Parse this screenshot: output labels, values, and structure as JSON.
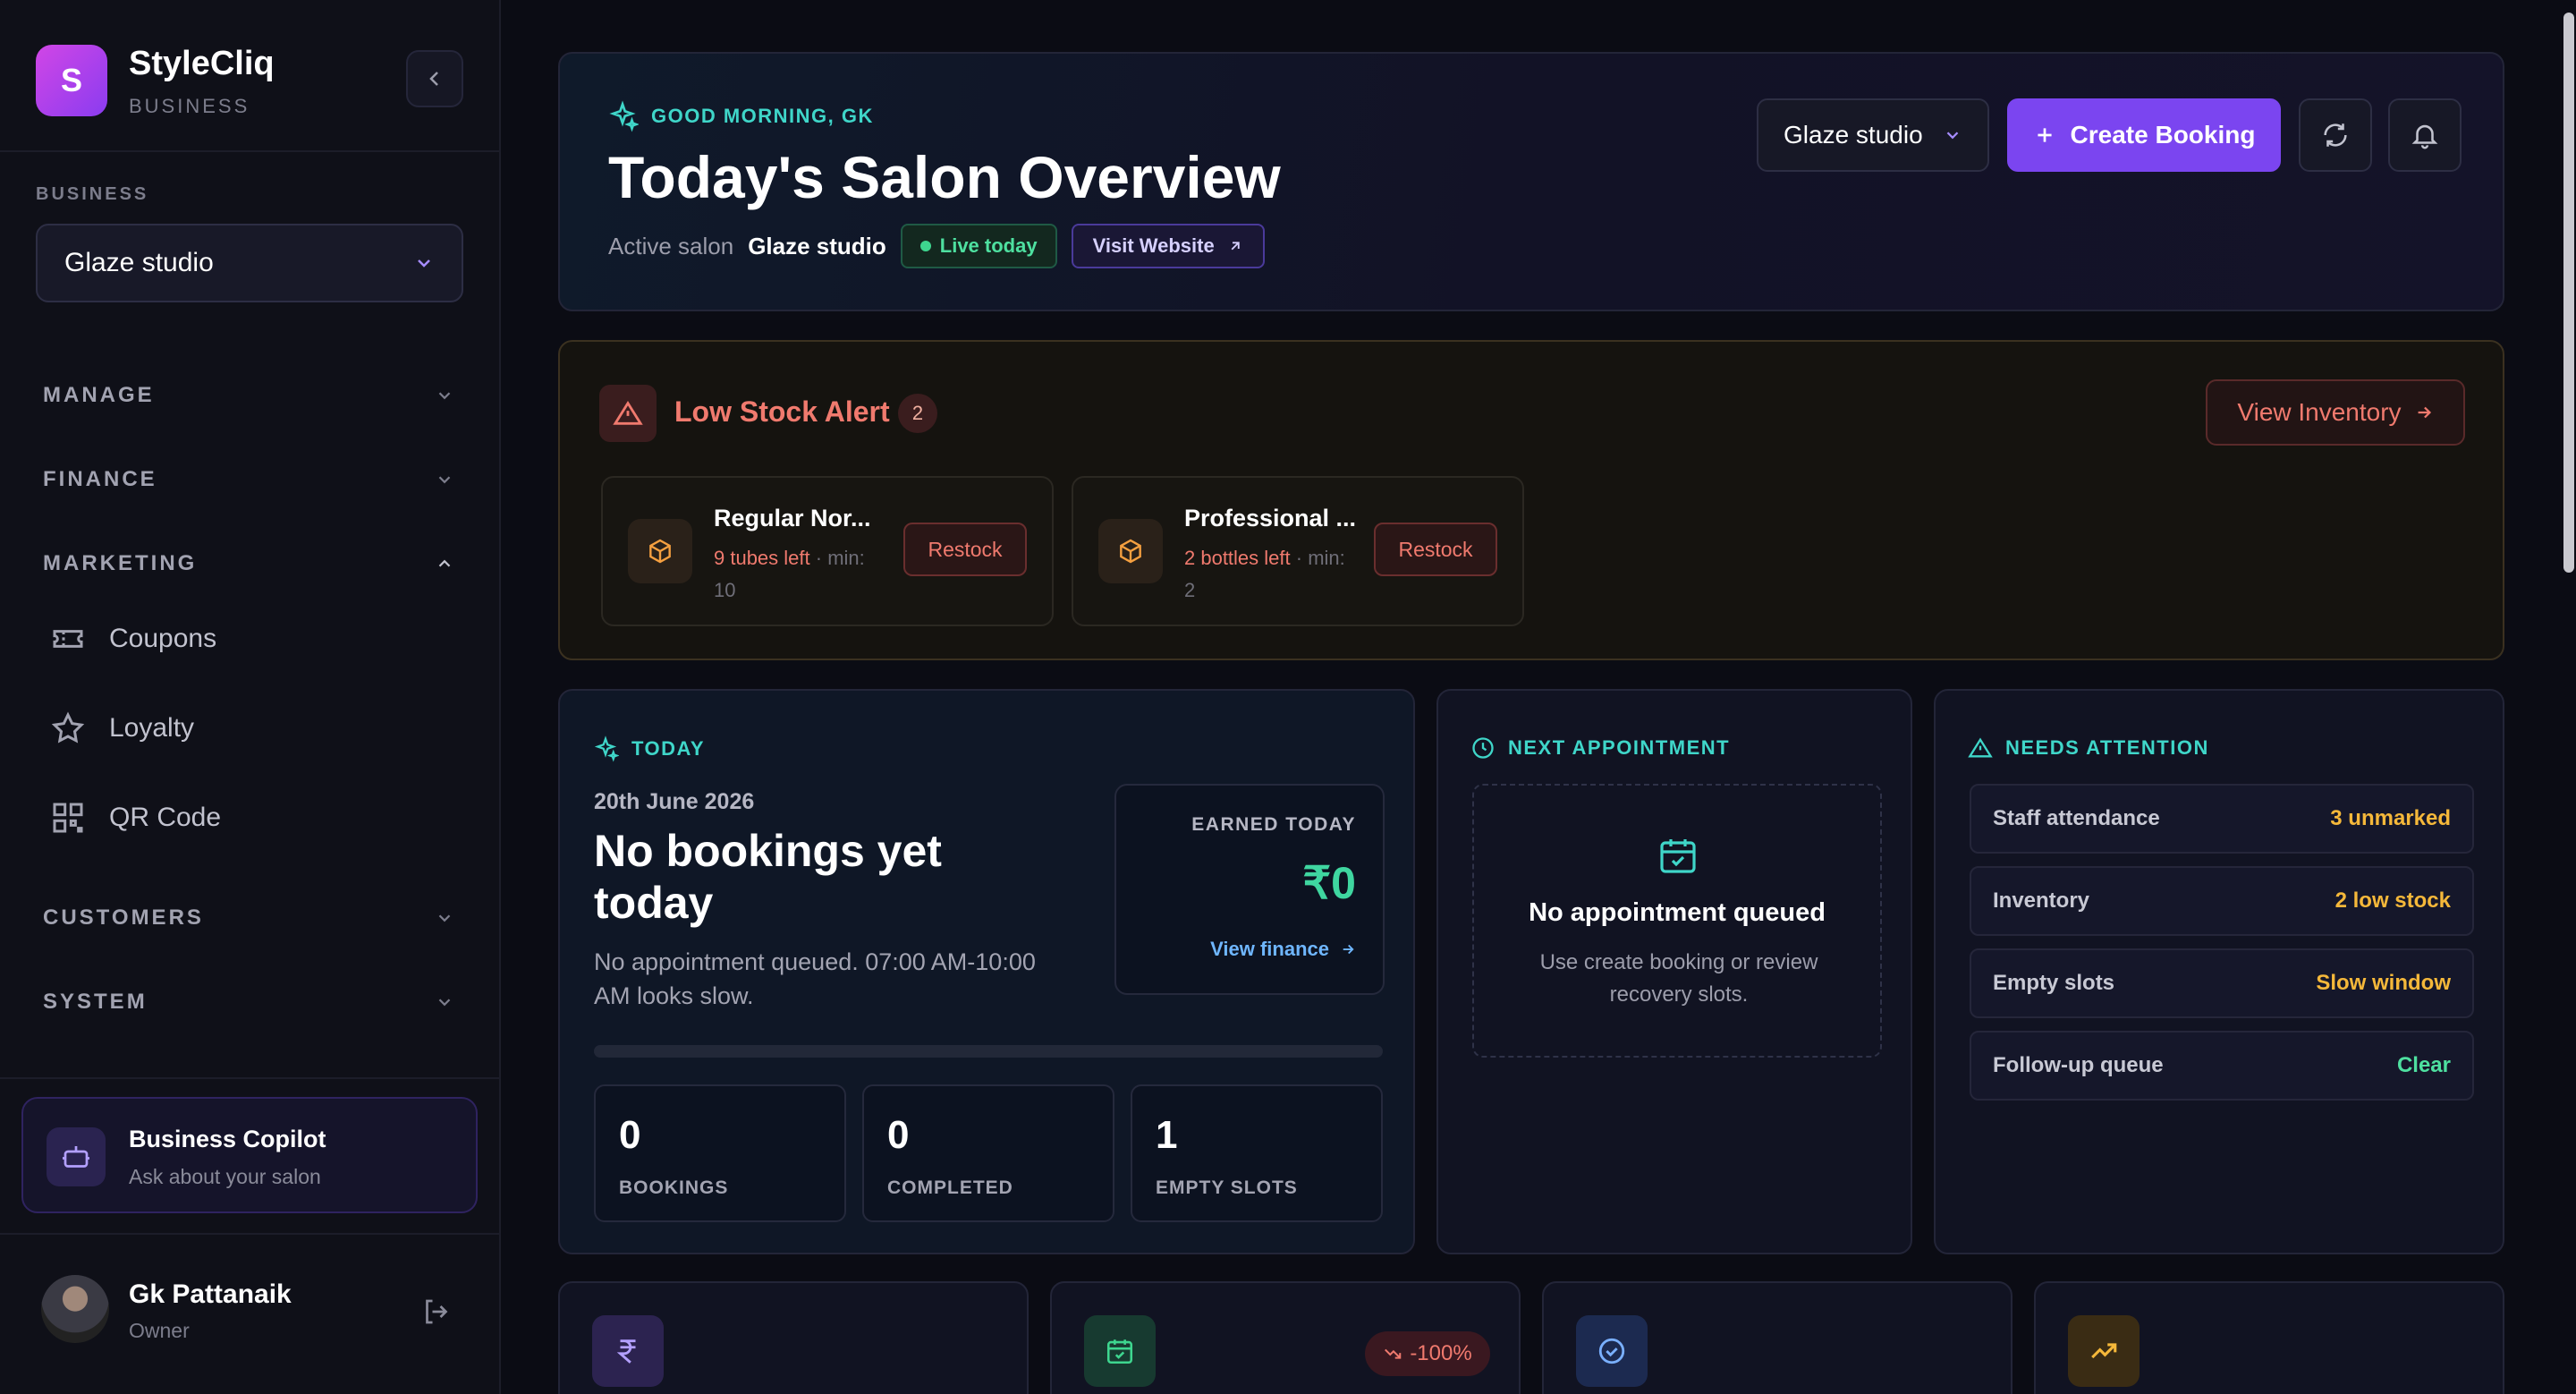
{
  "sidebar": {
    "logo_letter": "S",
    "brand_name": "StyleCliq",
    "brand_sub": "BUSINESS",
    "business_label": "BUSINESS",
    "business_selected": "Glaze studio",
    "sections": [
      {
        "label": "MANAGE",
        "expanded": false
      },
      {
        "label": "FINANCE",
        "expanded": false
      },
      {
        "label": "MARKETING",
        "expanded": true
      },
      {
        "label": "CUSTOMERS",
        "expanded": false
      },
      {
        "label": "SYSTEM",
        "expanded": false
      }
    ],
    "marketing_items": [
      {
        "label": "Coupons",
        "icon": "ticket-icon"
      },
      {
        "label": "Loyalty",
        "icon": "star-icon"
      },
      {
        "label": "QR Code",
        "icon": "qr-code-icon"
      }
    ],
    "copilot": {
      "title": "Business Copilot",
      "subtitle": "Ask about your salon"
    },
    "user": {
      "name": "Gk Pattanaik",
      "role": "Owner"
    }
  },
  "hero": {
    "greeting": "GOOD MORNING, GK",
    "title": "Today's Salon Overview",
    "active_label": "Active salon",
    "active_salon": "Glaze studio",
    "live_badge": "Live today",
    "visit_website": "Visit Website",
    "salon_select": "Glaze studio",
    "create_booking": "Create Booking"
  },
  "low_stock": {
    "title": "Low Stock Alert",
    "count": "2",
    "view_inventory": "View Inventory",
    "items": [
      {
        "name": "Regular Nor...",
        "left": "9 tubes left",
        "min_text": " · min: 10",
        "action": "Restock"
      },
      {
        "name": "Professional ...",
        "left": "2 bottles left",
        "min_text": " · min: 2",
        "action": "Restock"
      }
    ]
  },
  "today": {
    "label": "TODAY",
    "date": "20th June 2026",
    "headline": "No bookings yet today",
    "subtext": "No appointment queued. 07:00 AM-10:00 AM looks slow.",
    "earned_label": "EARNED TODAY",
    "earned_value": "₹0",
    "view_finance": "View finance",
    "progress": 0,
    "stats": [
      {
        "value": "0",
        "label": "BOOKINGS"
      },
      {
        "value": "0",
        "label": "COMPLETED"
      },
      {
        "value": "1",
        "label": "EMPTY SLOTS"
      }
    ]
  },
  "next_appointment": {
    "label": "NEXT APPOINTMENT",
    "title": "No appointment queued",
    "subtitle": "Use create booking or review recovery slots."
  },
  "needs_attention": {
    "label": "NEEDS ATTENTION",
    "items": [
      {
        "key": "Staff attendance",
        "value": "3 unmarked",
        "color": "#f5b83a"
      },
      {
        "key": "Inventory",
        "value": "2 low stock",
        "color": "#f5b83a"
      },
      {
        "key": "Empty slots",
        "value": "Slow window",
        "color": "#f5b83a"
      },
      {
        "key": "Follow-up queue",
        "value": "Clear",
        "color": "#4ee0a0"
      }
    ]
  },
  "kpis": [
    {
      "icon": "rupee-icon",
      "color": "#2c2350"
    },
    {
      "icon": "calendar-check-icon",
      "color": "#173a30",
      "delta": "-100%"
    },
    {
      "icon": "check-circle-icon",
      "color": "#1c2a50"
    },
    {
      "icon": "trending-up-icon",
      "color": "#3a2c14"
    }
  ]
}
